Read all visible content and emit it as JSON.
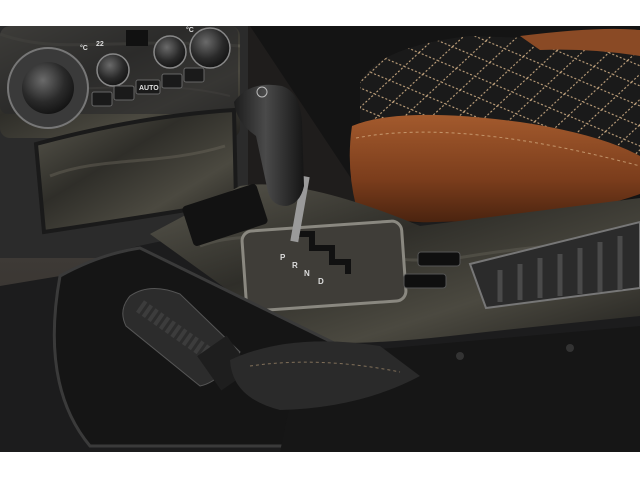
{
  "climate_panel": {
    "temp_marks": [
      "°C",
      "22",
      "°C"
    ],
    "auto_button_label": "AUTO"
  },
  "gear_selector": {
    "positions": [
      "P",
      "R",
      "N",
      "D"
    ]
  },
  "colors": {
    "background": "#ffffff",
    "burl_wood": "#3c3a33",
    "leather_cognac": "#8a4a25",
    "quilted_black": "#181818",
    "stitching": "#d8b58a",
    "console_black": "#1c1c1d"
  }
}
